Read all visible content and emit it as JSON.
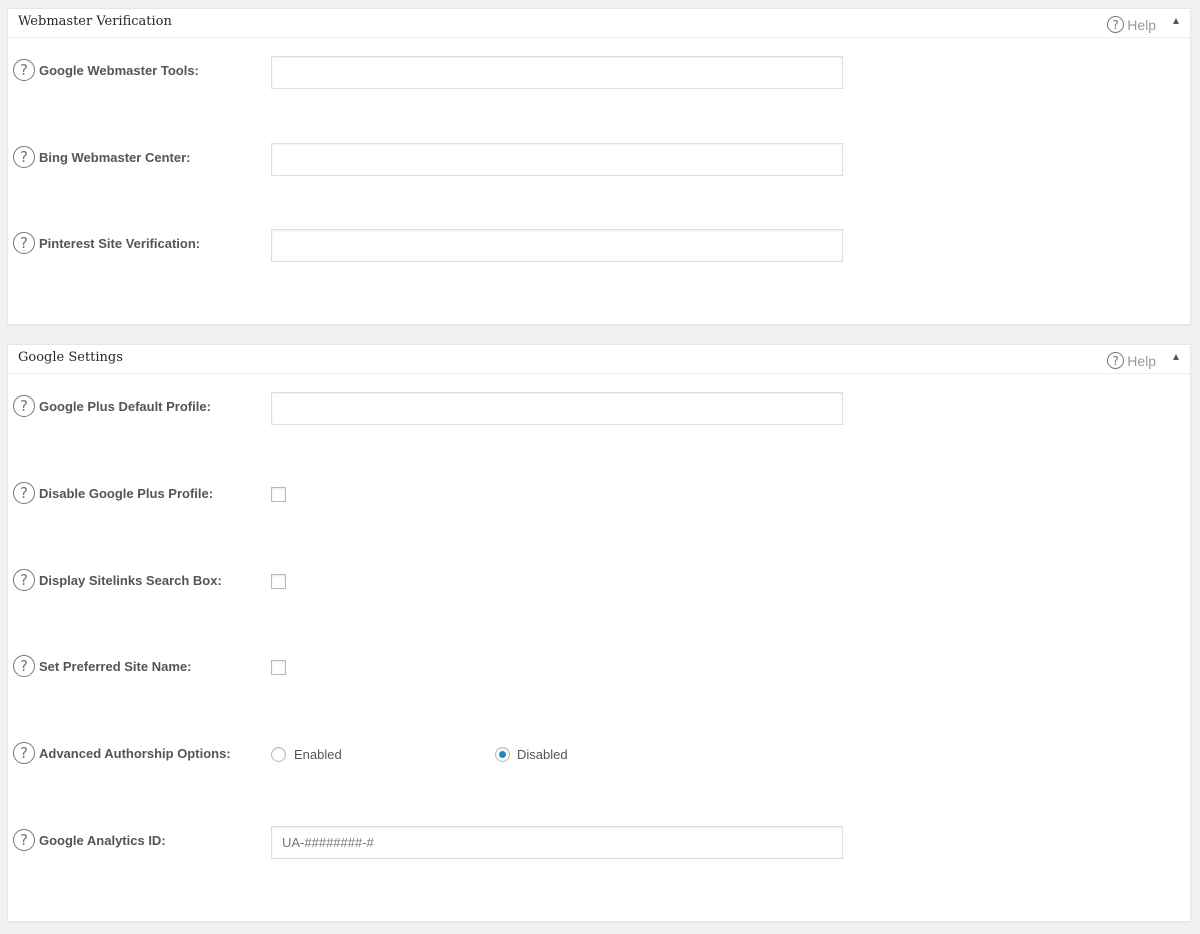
{
  "webmaster": {
    "title": "Webmaster Verification",
    "help_label": "Help",
    "fields": {
      "google_webmaster_tools": {
        "label": "Google Webmaster Tools:",
        "value": ""
      },
      "bing_webmaster_center": {
        "label": "Bing Webmaster Center:",
        "value": ""
      },
      "pinterest_site_verification": {
        "label": "Pinterest Site Verification:",
        "value": ""
      }
    }
  },
  "google": {
    "title": "Google Settings",
    "help_label": "Help",
    "fields": {
      "google_plus_default_profile": {
        "label": "Google Plus Default Profile:",
        "value": ""
      },
      "disable_google_plus_profile": {
        "label": "Disable Google Plus Profile:",
        "checked": false
      },
      "display_sitelinks_search_box": {
        "label": "Display Sitelinks Search Box:",
        "checked": false
      },
      "set_preferred_site_name": {
        "label": "Set Preferred Site Name:",
        "checked": false
      },
      "advanced_authorship_options": {
        "label": "Advanced Authorship Options:",
        "options": [
          "Enabled",
          "Disabled"
        ],
        "selected": "Disabled"
      },
      "google_analytics_id": {
        "label": "Google Analytics ID:",
        "value": "",
        "placeholder": "UA-########-#"
      }
    }
  },
  "icons": {
    "help": "question-circle-icon",
    "toggle": "arrow-up-icon"
  },
  "colors": {
    "accent": "#1e8cbe",
    "panel_bg": "#ffffff",
    "page_bg": "#f1f1f1"
  }
}
